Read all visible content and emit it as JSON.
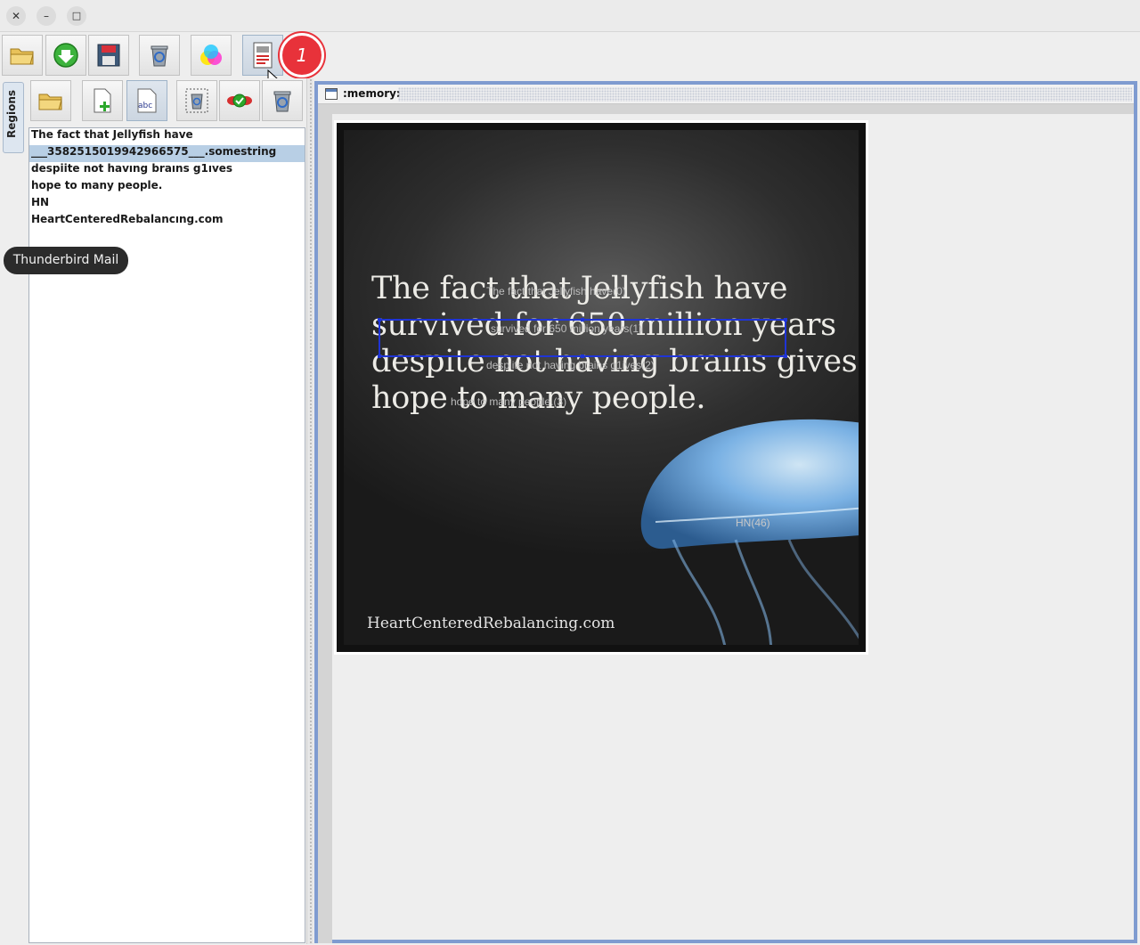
{
  "window": {
    "close": "✕",
    "minimize": "–",
    "maximize": "□"
  },
  "main_toolbar": {
    "buttons": [
      "open-folder-icon",
      "download-icon",
      "save-icon",
      "recycle-icon",
      "color-channels-icon",
      "document-report-icon"
    ],
    "step_badge": "1"
  },
  "side_tab": {
    "label": "Regions"
  },
  "regions_toolbar": {
    "buttons": [
      "open-folder-icon",
      "add-document-icon",
      "text-abc-icon",
      "region-recycle-icon",
      "validate-icon",
      "delete-recycle-icon"
    ]
  },
  "regions": [
    {
      "text": "The fact that Jellyfish have",
      "selected": false
    },
    {
      "text": "___3582515019942966575___.somestring",
      "selected": true
    },
    {
      "text": "despiite not havıng braıns g1ıves",
      "selected": false
    },
    {
      "text": "hope to many people.",
      "selected": false
    },
    {
      "text": "HN",
      "selected": false
    },
    {
      "text": "HeartCenteredRebalancıng.com",
      "selected": false
    }
  ],
  "tooltip": "Thunderbird Mail",
  "document": {
    "title": ":memory:",
    "image_lines": [
      "The fact that Jellyfish have",
      "survived for 650 million years",
      "despite not having brains gives",
      "hope to many people."
    ],
    "overlay_labels": [
      "The fact that Jellyfish have(0)",
      "survived for 650 million years(1)",
      "despiite not having brains g1ives(2)",
      "hope to many people.(3)"
    ],
    "hn_label": "HN(46)",
    "watermark": "HeartCenteredRebalancing.com"
  },
  "colors": {
    "accent": "#7f9bd0",
    "selection": "#b8cfe5",
    "badge": "#e8323a",
    "region_box": "#1f34d6"
  }
}
